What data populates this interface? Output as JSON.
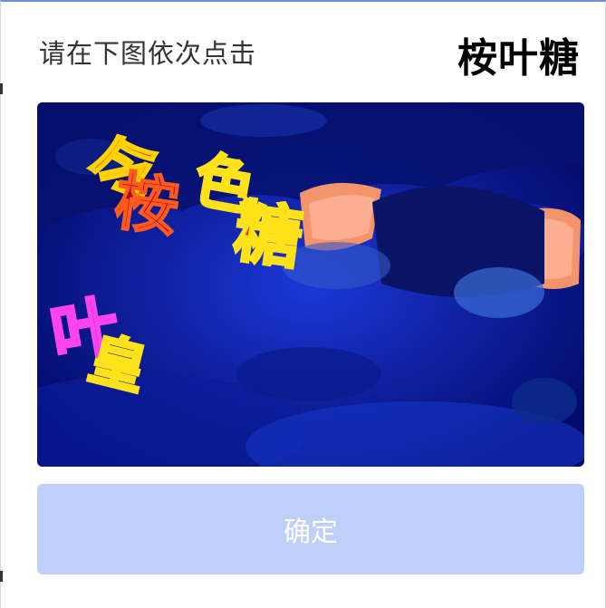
{
  "captcha": {
    "instruction": "请在下图依次点击",
    "target_chars": "桉叶糖",
    "image_glyphs": {
      "ling": "令",
      "xiao": "桉",
      "yu": "色",
      "tang": "糖",
      "ye": "叶",
      "wan": "皇"
    }
  },
  "confirm_button": {
    "label": "确定"
  },
  "colors": {
    "accent_border": "#6b8fe8",
    "button_disabled_bg": "#bfcffb",
    "image_base": "#0716a8"
  }
}
